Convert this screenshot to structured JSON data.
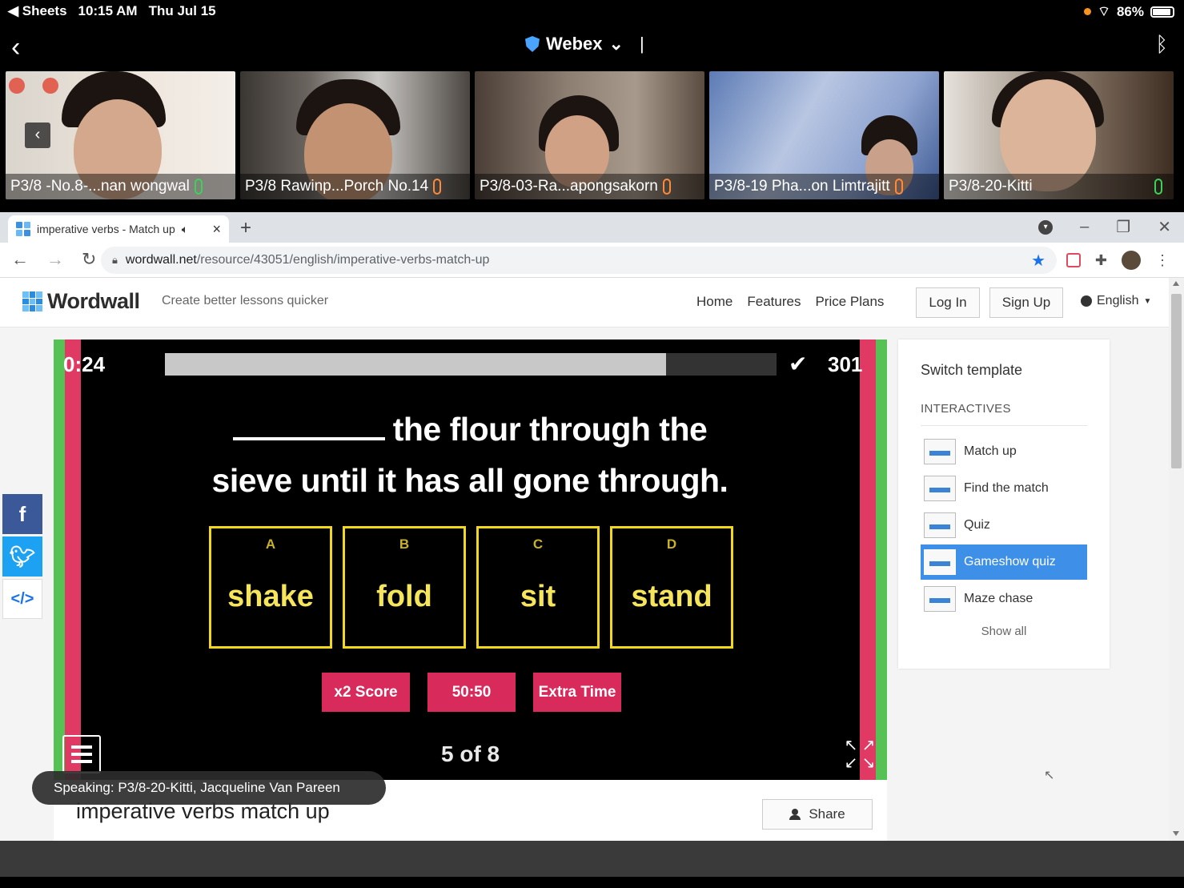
{
  "status_bar": {
    "back_app": "◀ Sheets",
    "time": "10:15 AM",
    "date": "Thu Jul 15",
    "battery": "86%"
  },
  "webex": {
    "title": "Webex",
    "participants": [
      {
        "name": "P3/8 -No.8-...nan wongwal",
        "mic": "on"
      },
      {
        "name": "P3/8 Rawinp...Porch No.14",
        "mic": "muted"
      },
      {
        "name": "P3/8-03-Ra...apongsakorn",
        "mic": "muted"
      },
      {
        "name": "P3/8-19 Pha...on Limtrajitt",
        "mic": "muted"
      },
      {
        "name": "P3/8-20-Kitti",
        "mic": "on"
      }
    ],
    "speaking": "Speaking: P3/8-20-Kitti, Jacqueline Van Pareen"
  },
  "browser": {
    "tab_title": "imperative verbs - Match up",
    "url_host": "wordwall.net",
    "url_path": "/resource/43051/english/imperative-verbs-match-up"
  },
  "site": {
    "logo": "Wordwall",
    "tagline": "Create better lessons quicker",
    "nav": [
      "Home",
      "Features",
      "Price Plans"
    ],
    "login": "Log In",
    "signup": "Sign Up",
    "language": "English"
  },
  "game": {
    "timer": "0:24",
    "progress_fraction": 0.82,
    "score": "301",
    "question_part1": "the flour through the",
    "question_part2": "sieve until it has all gone through.",
    "answers": [
      {
        "letter": "A",
        "word": "shake"
      },
      {
        "letter": "B",
        "word": "fold"
      },
      {
        "letter": "C",
        "word": "sit"
      },
      {
        "letter": "D",
        "word": "stand"
      }
    ],
    "powerups": [
      "x2 Score",
      "50:50",
      "Extra Time"
    ],
    "page_count": "5 of 8"
  },
  "switch_template": {
    "title": "Switch template",
    "section": "INTERACTIVES",
    "items": [
      {
        "label": "Match up",
        "active": false
      },
      {
        "label": "Find the match",
        "active": false
      },
      {
        "label": "Quiz",
        "active": false
      },
      {
        "label": "Gameshow quiz",
        "active": true
      },
      {
        "label": "Maze chase",
        "active": false
      }
    ],
    "show_all": "Show all"
  },
  "activity": {
    "title": "imperative verbs match up",
    "share": "Share"
  }
}
